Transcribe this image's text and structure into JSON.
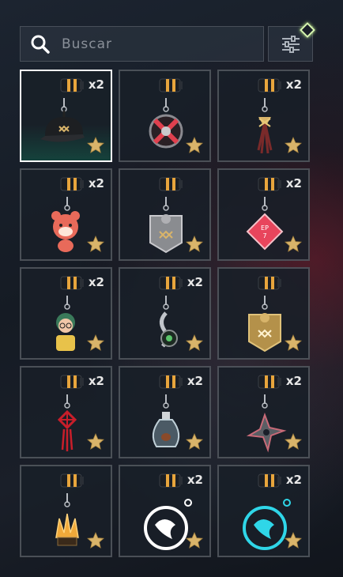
{
  "search": {
    "placeholder": "Buscar",
    "value": ""
  },
  "filter": {
    "icon": "sliders-icon",
    "indicator_color": "#c6f58f"
  },
  "colors": {
    "star": "#d9b46a",
    "selected_border": "#ffffff",
    "cell_border": "#4a525c"
  },
  "items": [
    {
      "name": "charm-cap",
      "count": "x2",
      "selected": true
    },
    {
      "name": "charm-red-emblem",
      "count": ""
    },
    {
      "name": "charm-braided-tassel",
      "count": "x2"
    },
    {
      "name": "charm-red-panda",
      "count": "x2"
    },
    {
      "name": "charm-silver-shield",
      "count": ""
    },
    {
      "name": "charm-pink-diamond",
      "count": "x2"
    },
    {
      "name": "charm-hooded-figure",
      "count": "x2"
    },
    {
      "name": "charm-green-hook",
      "count": "x2"
    },
    {
      "name": "charm-gold-shield",
      "count": ""
    },
    {
      "name": "charm-red-knot",
      "count": "x2"
    },
    {
      "name": "charm-glass-bottle",
      "count": "x2"
    },
    {
      "name": "charm-shuriken",
      "count": "x2"
    },
    {
      "name": "charm-golden-crystal",
      "count": ""
    },
    {
      "name": "charm-white-dragon-ring",
      "count": "x2"
    },
    {
      "name": "charm-cyan-dragon-ring",
      "count": "x2"
    }
  ]
}
